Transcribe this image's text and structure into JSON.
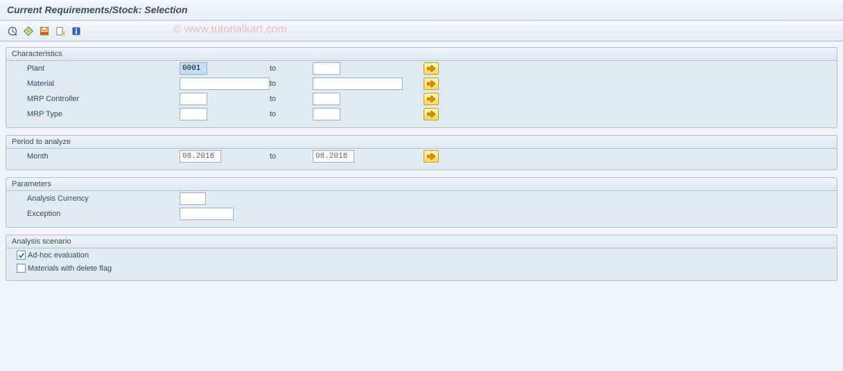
{
  "title": "Current Requirements/Stock: Selection",
  "watermark": "© www.tutorialkart.com",
  "toolbar": {
    "execute": "Execute",
    "variant": "Select Variant",
    "save": "Save",
    "create": "Create",
    "info": "Info"
  },
  "groups": {
    "characteristics": {
      "title": "Characteristics",
      "rows": {
        "plant": {
          "label": "Plant",
          "from": "0001",
          "to": "",
          "to_label": "to"
        },
        "material": {
          "label": "Material",
          "from": "",
          "to": "",
          "to_label": "to"
        },
        "mrp_controller": {
          "label": "MRP Controller",
          "from": "",
          "to": "",
          "to_label": "to"
        },
        "mrp_type": {
          "label": "MRP Type",
          "from": "",
          "to": "",
          "to_label": "to"
        }
      }
    },
    "period": {
      "title": "Period to analyze",
      "rows": {
        "month": {
          "label": "Month",
          "from": "08.2018",
          "to": "08.2018",
          "to_label": "to"
        }
      }
    },
    "parameters": {
      "title": "Parameters",
      "rows": {
        "currency": {
          "label": "Analysis Currency",
          "value": ""
        },
        "exception": {
          "label": "Exception",
          "value": ""
        }
      }
    },
    "scenario": {
      "title": "Analysis scenario",
      "checks": {
        "adhoc": {
          "label": "Ad-hoc evaluation",
          "checked": true
        },
        "delflag": {
          "label": "Materials with delete flag",
          "checked": false
        }
      }
    }
  }
}
